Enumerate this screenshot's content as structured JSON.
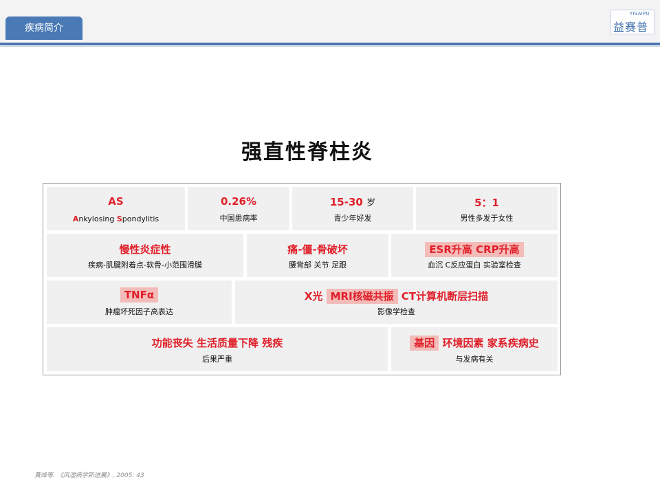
{
  "header": {
    "section_tab": "疾病简介",
    "logo_en": "YISAIPU",
    "logo_cn": "益赛普"
  },
  "title": "强直性脊柱炎",
  "rows": [
    {
      "cells": [
        {
          "top": "AS",
          "bottom_parts": [
            {
              "text": "A",
              "red": true
            },
            {
              "text": "nkylosing ",
              "red": false
            },
            {
              "text": "S",
              "red": true
            },
            {
              "text": "pondylitis",
              "red": false
            }
          ]
        },
        {
          "top": "0.26%",
          "bottom": "中国患病率"
        },
        {
          "top": "15-30",
          "top_suffix": "岁",
          "bottom": "青少年好发"
        },
        {
          "top": "5：1",
          "bottom": "男性多发于女性"
        }
      ]
    },
    {
      "cells": [
        {
          "top": "慢性炎症性",
          "bottom": "疾病-肌腱附着点-软骨-小范围滑膜"
        },
        {
          "top": "痛-僵-骨破坏",
          "bottom": "腰背部  关节  足跟"
        },
        {
          "top": "ESR升高 CRP升高",
          "bottom": "血沉 C反应蛋白  实验室检查"
        }
      ]
    },
    {
      "cells": [
        {
          "top": "TNFα",
          "bottom": "肿瘤坏死因子高表达"
        },
        {
          "top_parts": [
            {
              "text": "X光",
              "hl": false
            },
            {
              "text": "MRI核磁共振",
              "hl": true
            },
            {
              "text": "CT计算机断层扫描",
              "hl": false
            }
          ],
          "bottom": "影像学检查"
        }
      ]
    },
    {
      "cells": [
        {
          "top": "功能丧失  生活质量下降  残疾",
          "bottom": "后果严重"
        },
        {
          "top_parts": [
            {
              "text": "基因",
              "hl": true
            },
            {
              "text": "环境因素 家系疾病史",
              "hl": false
            }
          ],
          "bottom": "与发病有关"
        }
      ]
    }
  ],
  "footer": "黄烽等. 《风湿病学新进展》, 2005: 43",
  "colors": {
    "accent_red": "#e0202a",
    "highlight": "#f3bcb8",
    "header_blue": "#4a7ab5",
    "cell_bg": "#f0f0f0"
  }
}
